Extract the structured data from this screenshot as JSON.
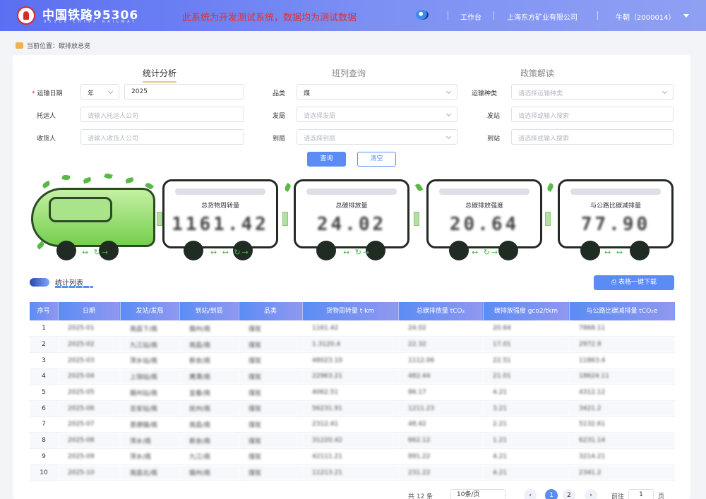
{
  "header": {
    "brand": "中国铁路95306",
    "brand_sub": "95306 CHINA RAILWAY",
    "banner": "此系统为开发测试系统，数据均为测试数据",
    "links": [
      "工作台",
      "上海东方矿业有限公司",
      "牛朝（2000014）"
    ]
  },
  "breadcrumb": {
    "label": "当前位置：",
    "current": "碳排放总览"
  },
  "tabs": [
    {
      "label": "统计分析",
      "active": true
    },
    {
      "label": "班列查询",
      "active": false
    },
    {
      "label": "政策解读",
      "active": false
    }
  ],
  "form": {
    "transport_date": {
      "label": "运输日期",
      "unit": "年",
      "year": "2025"
    },
    "category": {
      "label": "品类",
      "value": "煤"
    },
    "transport_type": {
      "label": "运输种类",
      "placeholder": "请选择运输种类"
    },
    "consignor": {
      "label": "托运人",
      "placeholder": "请输入托运人公司"
    },
    "from_bureau": {
      "label": "发局",
      "placeholder": "请选择发局"
    },
    "from_station": {
      "label": "发站",
      "placeholder": "请选择或输入搜索"
    },
    "consignee": {
      "label": "收货人",
      "placeholder": "请输入收货人公司"
    },
    "to_bureau": {
      "label": "到局",
      "placeholder": "请选择到局"
    },
    "to_station": {
      "label": "到站",
      "placeholder": "请选择或输入搜索"
    },
    "query_button": "查询",
    "clear_button": "清空"
  },
  "stats": [
    {
      "title": "总货物周转量",
      "value": "1161.42"
    },
    {
      "title": "总碳排放量",
      "value": "24.02"
    },
    {
      "title": "总碳排放强度",
      "value": "20.64"
    },
    {
      "title": "与公路比碳减排量",
      "value": "77.90"
    }
  ],
  "list": {
    "title": "统计列表",
    "download_button": "表格一键下载",
    "columns": [
      "序号",
      "日期",
      "发站/发局",
      "到站/到局",
      "品类",
      "货物周转量 t·km",
      "总碳排放量 tCO₂",
      "碳排放强度 gco2/tkm",
      "与公路比碳减排量 tCO₂e"
    ],
    "rows": [
      [
        "1",
        "2025-01",
        "南昌下/南",
        "赣州/南",
        "煤炭",
        "1161.42",
        "24.02",
        "20.64",
        "7868.11"
      ],
      [
        "2",
        "2025-02",
        "九江站/南",
        "南昌/南",
        "煤炭",
        "1.3120.4",
        "22.32",
        "17.01",
        "2972.9"
      ],
      [
        "3",
        "2025-03",
        "萍乡站/南",
        "新余/南",
        "煤炭",
        "48023.10",
        "1112.06",
        "22.51",
        "11863.4"
      ],
      [
        "4",
        "2025-04",
        "上饶站/南",
        "鹰潭/南",
        "煤炭",
        "22963.21",
        "482.44",
        "21.01",
        "18624.11"
      ],
      [
        "5",
        "2025-05",
        "赣州站/南",
        "宜春/南",
        "煤炭",
        "4062.51",
        "86.17",
        "4.21",
        "4312.12"
      ],
      [
        "6",
        "2025-06",
        "吉安站/南",
        "抚州/南",
        "煤炭",
        "56231.91",
        "1211.23",
        "3.21",
        "3421.2"
      ],
      [
        "7",
        "2025-07",
        "景德镇/南",
        "南昌/南",
        "煤炭",
        "2312.41",
        "48.42",
        "2.21",
        "5132.61"
      ],
      [
        "8",
        "2025-08",
        "萍乡/南",
        "新余/南",
        "煤炭",
        "31220.42",
        "662.12",
        "1.21",
        "6231.14"
      ],
      [
        "9",
        "2025-09",
        "萍乡/南",
        "九江/南",
        "煤炭",
        "42111.21",
        "891.22",
        "4.21",
        "3214.21"
      ],
      [
        "10",
        "2025-10",
        "南昌北/南",
        "赣州/南",
        "煤炭",
        "11213.21",
        "231.22",
        "4.21",
        "2341.2"
      ]
    ]
  },
  "pagination": {
    "total": "共 12 条",
    "page_size": "10条/页",
    "pages": [
      "1",
      "2"
    ],
    "goto_label": "前往",
    "goto_value": "1",
    "page_unit": "页"
  }
}
